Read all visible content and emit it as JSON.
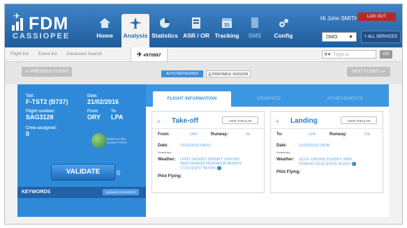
{
  "brand": {
    "name": "FDM",
    "sub": "CASSIOPEE"
  },
  "nav": [
    {
      "label": "Home",
      "icon": "home-icon"
    },
    {
      "label": "Analysis",
      "icon": "plane-icon"
    },
    {
      "label": "Statistics",
      "icon": "pie-chart-icon"
    },
    {
      "label": "ASR / OR",
      "icon": "report-icon"
    },
    {
      "label": "Tracking",
      "icon": "calendar-icon"
    },
    {
      "label": "SMS",
      "icon": "document-icon"
    },
    {
      "label": "Config",
      "icon": "gears-icon"
    }
  ],
  "user": {
    "greeting": "Hi John SMITH!",
    "logout": "LOG OUT"
  },
  "org_select": {
    "value": "DMO"
  },
  "services_button": "ALL SERVICES",
  "tabs": {
    "flight_list": "Flight list",
    "event_list": "Event list",
    "advanced_search": "Advanced Search",
    "current": "#970697"
  },
  "flight_search": {
    "placeholder": "Flight id",
    "go": "GO"
  },
  "toolbar": {
    "previous": "<< PREVIOUS FLIGHT",
    "next": "NEXT FLIGHT >>",
    "auto_refresh": "AUTO REFRESHED",
    "printable": "PRINTABLE VERSION"
  },
  "flight": {
    "tail_label": "Tail:",
    "tail": "F-TST2 (B737)",
    "date_label": "Date:",
    "date": "21/02/2016",
    "flight_number_label": "Flight number:",
    "flight_number": "SAG3128",
    "from_label": "From",
    "from": "ORY",
    "to_label": "To",
    "to": "LPA",
    "crew_label": "Crew assigned:",
    "crew": "0",
    "globe_text": "DISPLAY ON FLIGHT PATH"
  },
  "validate": {
    "label": "VALIDATE",
    "count": "0"
  },
  "keywords": {
    "label": "KEYWORDS",
    "button": "MANAGE KEYWORDS"
  },
  "right_tabs": [
    "FLIGHT INFORMATION",
    "GRAPHICS",
    "ACHIEVEMENTS"
  ],
  "takeoff": {
    "title": "Take-off",
    "view": "VIEW TABULAR",
    "from_label": "From:",
    "from": "ORY",
    "runway_label": "Runway:",
    "runway": "26",
    "date_label": "Date:",
    "date": "21/02/2016 09h11",
    "scheduled_label": "Scheduled:",
    "weather_label": "Weather:",
    "weather": "LFPO 142000Z 25009KT 220V300 9999 FEW033 FEW040CB BKN073 17/12 Q1017 NOSIG",
    "pilot_label": "Pilot Flying:",
    "pilot": "-"
  },
  "landing": {
    "title": "Landing",
    "view": "VIEW TABULAR",
    "to_label": "To:",
    "to": "LPA",
    "runway_label": "Runway:",
    "runway": "03L",
    "date_label": "Date:",
    "date": "21/02/2016 13h35",
    "scheduled_label": "Scheduled:",
    "weather_label": "Weather:",
    "weather": "GCLP 130030Z 01025KT 9999 FEW030 24/16 Q1016 NOSIG",
    "pilot_label": "Pilot Flying:",
    "pilot": "-"
  }
}
